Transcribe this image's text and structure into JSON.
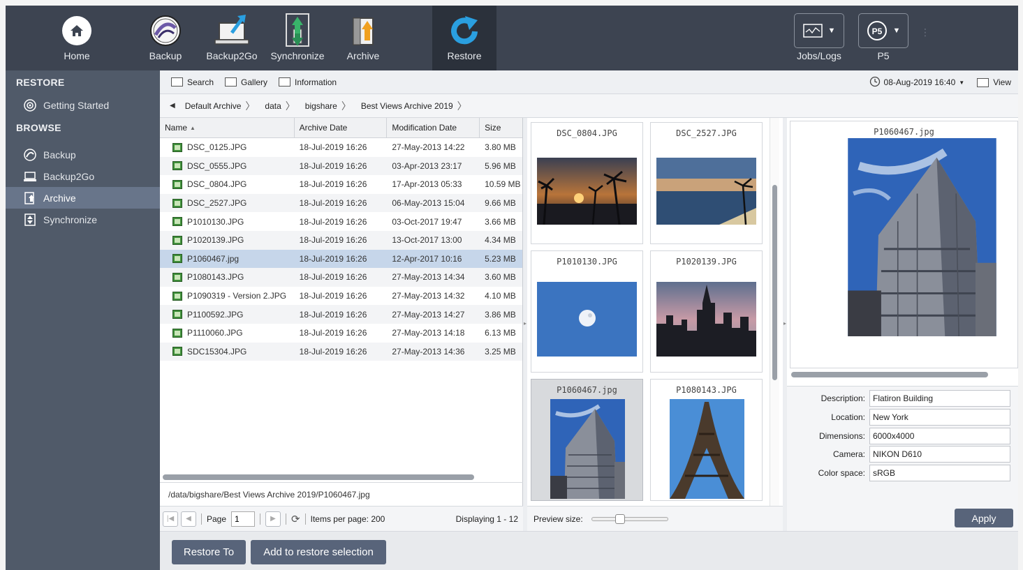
{
  "topbar": {
    "left_buttons": [
      {
        "label": "Home",
        "icon": "home-icon"
      },
      {
        "label": "Backup",
        "icon": "backup-icon"
      },
      {
        "label": "Backup2Go",
        "icon": "backup2go-icon"
      },
      {
        "label": "Synchronize",
        "icon": "synchronize-icon"
      },
      {
        "label": "Archive",
        "icon": "archive-icon"
      },
      {
        "label": "Restore",
        "icon": "restore-icon",
        "active": true
      }
    ],
    "right_buttons": [
      {
        "label": "Jobs/Logs",
        "icon": "jobs-logs-icon"
      },
      {
        "label": "P5",
        "icon": "p5-server-icon",
        "badge": "P5"
      }
    ]
  },
  "sidebar": {
    "restore_heading": "RESTORE",
    "restore_items": [
      {
        "label": "Getting Started",
        "icon": "getting-started-icon"
      }
    ],
    "browse_heading": "BROWSE",
    "browse_items": [
      {
        "label": "Backup",
        "icon": "backup-icon"
      },
      {
        "label": "Backup2Go",
        "icon": "backup2go-icon"
      },
      {
        "label": "Archive",
        "icon": "archive-icon",
        "active": true
      },
      {
        "label": "Synchronize",
        "icon": "synchronize-icon"
      }
    ]
  },
  "subtoolbar": {
    "search": "Search",
    "gallery": "Gallery",
    "information": "Information",
    "date": "08-Aug-2019 16:40",
    "view": "View"
  },
  "breadcrumb": [
    "Default Archive",
    "data",
    "bigshare",
    "Best Views Archive 2019"
  ],
  "table": {
    "headers": {
      "name": "Name",
      "archive_date": "Archive Date",
      "modification_date": "Modification Date",
      "size": "Size"
    },
    "rows": [
      {
        "name": "DSC_0125.JPG",
        "archive_date": "18-Jul-2019 16:26",
        "mod_date": "27-May-2013 14:22",
        "size": "3.80 MB"
      },
      {
        "name": "DSC_0555.JPG",
        "archive_date": "18-Jul-2019 16:26",
        "mod_date": "03-Apr-2013 23:17",
        "size": "5.96 MB"
      },
      {
        "name": "DSC_0804.JPG",
        "archive_date": "18-Jul-2019 16:26",
        "mod_date": "17-Apr-2013 05:33",
        "size": "10.59 MB"
      },
      {
        "name": "DSC_2527.JPG",
        "archive_date": "18-Jul-2019 16:26",
        "mod_date": "06-May-2013 15:04",
        "size": "9.66 MB"
      },
      {
        "name": "P1010130.JPG",
        "archive_date": "18-Jul-2019 16:26",
        "mod_date": "03-Oct-2017 19:47",
        "size": "3.66 MB"
      },
      {
        "name": "P1020139.JPG",
        "archive_date": "18-Jul-2019 16:26",
        "mod_date": "13-Oct-2017 13:00",
        "size": "4.34 MB"
      },
      {
        "name": "P1060467.jpg",
        "archive_date": "18-Jul-2019 16:26",
        "mod_date": "12-Apr-2017 10:16",
        "size": "5.23 MB",
        "selected": true
      },
      {
        "name": "P1080143.JPG",
        "archive_date": "18-Jul-2019 16:26",
        "mod_date": "27-May-2013 14:34",
        "size": "3.60 MB"
      },
      {
        "name": "P1090319 - Version 2.JPG",
        "archive_date": "18-Jul-2019 16:26",
        "mod_date": "27-May-2013 14:32",
        "size": "4.10 MB"
      },
      {
        "name": "P1100592.JPG",
        "archive_date": "18-Jul-2019 16:26",
        "mod_date": "27-May-2013 14:27",
        "size": "3.86 MB"
      },
      {
        "name": "P1110060.JPG",
        "archive_date": "18-Jul-2019 16:26",
        "mod_date": "27-May-2013 14:18",
        "size": "6.13 MB"
      },
      {
        "name": "SDC15304.JPG",
        "archive_date": "18-Jul-2019 16:26",
        "mod_date": "27-May-2013 14:36",
        "size": "3.25 MB"
      }
    ]
  },
  "path": "/data/bigshare/Best Views Archive 2019/P1060467.jpg",
  "pager": {
    "page_label": "Page",
    "page_value": "1",
    "items_per_page": "Items per page: 200",
    "displaying": "Displaying 1 - 12"
  },
  "gallery": {
    "tiles": [
      {
        "name": "DSC_0804.JPG",
        "scene": "tropical-sunset"
      },
      {
        "name": "DSC_2527.JPG",
        "scene": "beach-sunset"
      },
      {
        "name": "P1010130.JPG",
        "scene": "moon-blue-sky"
      },
      {
        "name": "P1020139.JPG",
        "scene": "city-skyline-dusk"
      },
      {
        "name": "P1060467.jpg",
        "scene": "flatiron-building",
        "selected": true
      },
      {
        "name": "P1080143.JPG",
        "scene": "eiffel-tower"
      }
    ],
    "preview_size_label": "Preview size:",
    "preview_size_level": 0.35
  },
  "preview": {
    "filename": "P1060467.jpg",
    "metadata": [
      {
        "label": "Description:",
        "value": "Flatiron Building"
      },
      {
        "label": "Location:",
        "value": "New York"
      },
      {
        "label": "Dimensions:",
        "value": "6000x4000"
      },
      {
        "label": "Camera:",
        "value": "NIKON D610"
      },
      {
        "label": "Color space:",
        "value": "sRGB"
      }
    ],
    "apply_label": "Apply"
  },
  "actions": {
    "restore_to": "Restore To",
    "add_to_selection": "Add to restore selection"
  },
  "colors": {
    "toolbar_bg": "#3d4451",
    "sidebar_bg": "#505a69",
    "button_bg": "#58647a",
    "selection": "#c6d6ea",
    "restore_accent": "#2a9fe0"
  }
}
